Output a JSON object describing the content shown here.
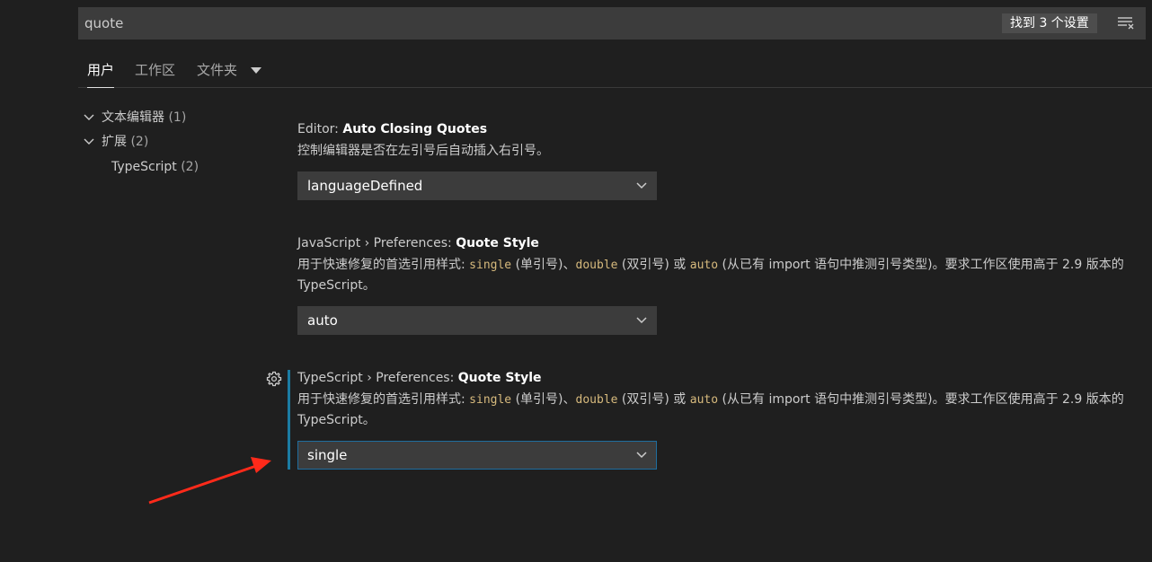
{
  "search": {
    "value": "quote",
    "result_count": "找到 3 个设置",
    "filter_icon": "clear-filter-icon"
  },
  "tabs": [
    {
      "label": "用户",
      "active": true
    },
    {
      "label": "工作区",
      "active": false
    },
    {
      "label": "文件夹",
      "active": false
    }
  ],
  "toc": [
    {
      "label": "文本编辑器",
      "count": "(1)",
      "expanded": true
    },
    {
      "label": "扩展",
      "count": "(2)",
      "expanded": true
    },
    {
      "label": "TypeScript",
      "count": "(2)"
    }
  ],
  "settings": [
    {
      "category": "Editor: ",
      "name": "Auto Closing Quotes",
      "description": "控制编辑器是否在左引号后自动插入右引号。",
      "value": "languageDefined"
    },
    {
      "category": "JavaScript › Preferences: ",
      "name": "Quote Style",
      "desc_parts": {
        "p1": "用于快速修复的首选引用样式: ",
        "c1": "single",
        "p2": " (单引号)、",
        "c2": "double",
        "p3": " (双引号) 或 ",
        "c3": "auto",
        "p4": " (从已有 import 语句中推测引号类型)。要求工作区使用高于 2.9 版本的 TypeScript。"
      },
      "value": "auto"
    },
    {
      "category": "TypeScript › Preferences: ",
      "name": "Quote Style",
      "desc_parts": {
        "p1": "用于快速修复的首选引用样式: ",
        "c1": "single",
        "p2": " (单引号)、",
        "c2": "double",
        "p3": " (双引号) 或 ",
        "c3": "auto",
        "p4": " (从已有 import 语句中推测引号类型)。要求工作区使用高于 2.9 版本的 TypeScript。"
      },
      "value": "single",
      "modified": true
    }
  ],
  "colors": {
    "background": "#1f1f1f",
    "input_background": "#3c3c3c",
    "modified_indicator": "#1b7ca3",
    "code_text": "#d7ba7d",
    "annotation_arrow": "#ff2a1a"
  }
}
